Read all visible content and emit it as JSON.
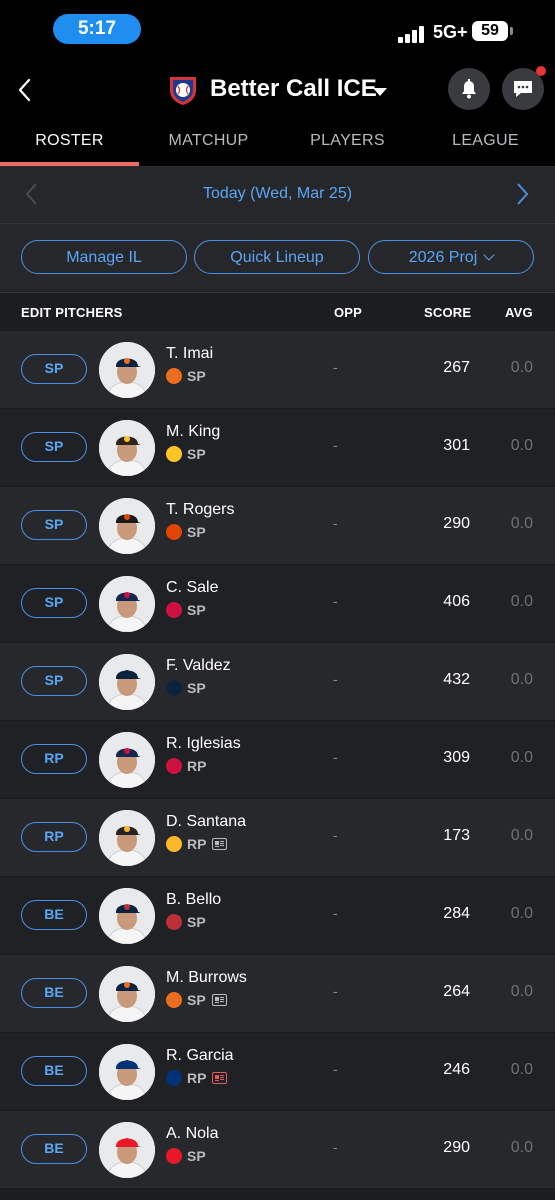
{
  "status": {
    "time": "5:17",
    "network": "5G+",
    "battery": "59"
  },
  "header": {
    "team_name": "Better Call ICE"
  },
  "tabs": [
    "ROSTER",
    "MATCHUP",
    "PLAYERS",
    "LEAGUE"
  ],
  "active_tab": "ROSTER",
  "date": {
    "label": "Today (Wed, Mar 25)"
  },
  "actions": {
    "manage_il": "Manage IL",
    "quick_lineup": "Quick Lineup",
    "projection": "2026 Proj"
  },
  "table": {
    "title": "EDIT PITCHERS",
    "col_opp": "OPP",
    "col_score": "SCORE",
    "col_avg": "AVG"
  },
  "players": [
    {
      "slot": "SP",
      "name": "T. Imai",
      "pos": "SP",
      "opp": "-",
      "score": "267",
      "avg": "0.0",
      "team_icon": "astros-logo",
      "team_color": "#eb6e1f",
      "cap_color": "#0c2340",
      "news": ""
    },
    {
      "slot": "SP",
      "name": "M. King",
      "pos": "SP",
      "opp": "-",
      "score": "301",
      "avg": "0.0",
      "team_icon": "padres-logo",
      "team_color": "#ffc425",
      "cap_color": "#2f241d",
      "news": ""
    },
    {
      "slot": "SP",
      "name": "T. Rogers",
      "pos": "SP",
      "opp": "-",
      "score": "290",
      "avg": "0.0",
      "team_icon": "orioles-logo",
      "team_color": "#df4601",
      "cap_color": "#1a1a1a",
      "news": ""
    },
    {
      "slot": "SP",
      "name": "C. Sale",
      "pos": "SP",
      "opp": "-",
      "score": "406",
      "avg": "0.0",
      "team_icon": "braves-logo",
      "team_color": "#ce1141",
      "cap_color": "#13274f",
      "news": ""
    },
    {
      "slot": "SP",
      "name": "F. Valdez",
      "pos": "SP",
      "opp": "-",
      "score": "432",
      "avg": "0.0",
      "team_icon": "tigers-logo",
      "team_color": "#0c2340",
      "cap_color": "#0c2340",
      "news": ""
    },
    {
      "slot": "RP",
      "name": "R. Iglesias",
      "pos": "RP",
      "opp": "-",
      "score": "309",
      "avg": "0.0",
      "team_icon": "braves-logo",
      "team_color": "#ce1141",
      "cap_color": "#13274f",
      "news": ""
    },
    {
      "slot": "RP",
      "name": "D. Santana",
      "pos": "RP",
      "opp": "-",
      "score": "173",
      "avg": "0.0",
      "team_icon": "pirates-logo",
      "team_color": "#fdb827",
      "cap_color": "#27251f",
      "news": "gray"
    },
    {
      "slot": "BE",
      "name": "B. Bello",
      "pos": "SP",
      "opp": "-",
      "score": "284",
      "avg": "0.0",
      "team_icon": "red-sox-logo",
      "team_color": "#bd3039",
      "cap_color": "#0c2340",
      "news": ""
    },
    {
      "slot": "BE",
      "name": "M. Burrows",
      "pos": "SP",
      "opp": "-",
      "score": "264",
      "avg": "0.0",
      "team_icon": "astros-logo",
      "team_color": "#eb6e1f",
      "cap_color": "#0c2340",
      "news": "gray"
    },
    {
      "slot": "BE",
      "name": "R. Garcia",
      "pos": "RP",
      "opp": "-",
      "score": "246",
      "avg": "0.0",
      "team_icon": "rangers-logo",
      "team_color": "#003278",
      "cap_color": "#003278",
      "news": "red"
    },
    {
      "slot": "BE",
      "name": "A. Nola",
      "pos": "SP",
      "opp": "-",
      "score": "290",
      "avg": "0.0",
      "team_icon": "phillies-logo",
      "team_color": "#e81828",
      "cap_color": "#e81828",
      "news": ""
    }
  ]
}
